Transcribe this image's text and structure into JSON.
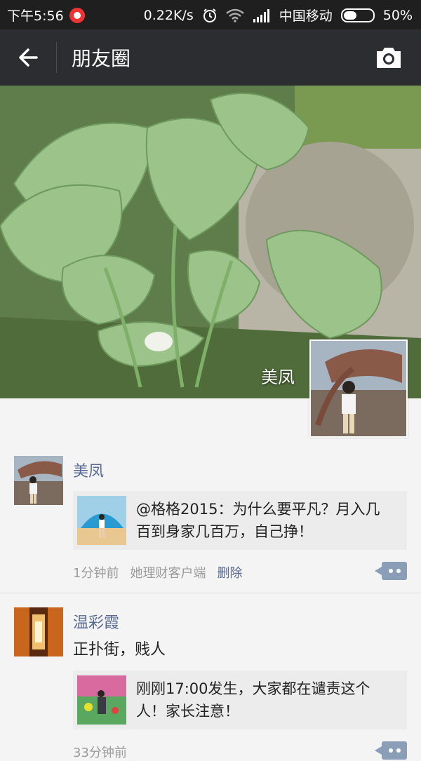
{
  "status_bar": {
    "time": "下午5:56",
    "speed": "0.22K/s",
    "carrier": "中国移动",
    "battery": "50%",
    "battery_level": 0.5
  },
  "header": {
    "title": "朋友圈",
    "back_icon": "back-arrow-icon",
    "camera_icon": "camera-icon"
  },
  "cover": {
    "user_name": "美凤"
  },
  "posts": [
    {
      "author": "美凤",
      "text": "",
      "share_text": "@格格2015：为什么要平凡？月入几百到身家几百万，自己挣！",
      "time": "1分钟前",
      "source": "她理财客户端",
      "delete_label": "删除"
    },
    {
      "author": "温彩霞",
      "text": "正扑街，贱人",
      "share_text": "刚刚17:00发生，大家都在谴责这个人！家长注意！",
      "time": "33分钟前"
    }
  ],
  "colors": {
    "name_blue": "#576b95",
    "header_bg": "#2b2d30",
    "status_bg": "#1f1f1f"
  }
}
